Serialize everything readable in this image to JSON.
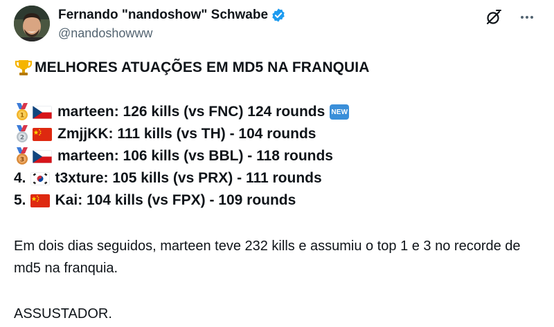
{
  "author": {
    "display_name": "Fernando \"nandoshow\" Schwabe",
    "handle": "@nandoshowww",
    "verified": true
  },
  "header_actions": {
    "icons": [
      "grok-icon",
      "more-icon"
    ]
  },
  "tweet": {
    "headline": "MELHORES ATUAÇÕES EM MD5 NA FRANQUIA",
    "rankings": [
      {
        "rank_label": "",
        "medal": "gold",
        "flag": "czech",
        "text": "marteen: 126 kills (vs FNC) 124 rounds",
        "new_badge": "NEW"
      },
      {
        "rank_label": "",
        "medal": "silver",
        "flag": "china",
        "text": "ZmjjKK: 111 kills (vs TH) - 104 rounds"
      },
      {
        "rank_label": "",
        "medal": "bronze",
        "flag": "czech",
        "text": "marteen: 106 kills (vs BBL) - 118 rounds"
      },
      {
        "rank_label": "4.",
        "medal": "",
        "flag": "korea",
        "text": "t3xture: 105 kills (vs PRX) - 111 rounds"
      },
      {
        "rank_label": "5.",
        "medal": "",
        "flag": "china",
        "text": "Kai: 104 kills (vs FPX) - 109 rounds"
      }
    ],
    "paragraph": "Em dois dias seguidos, marteen teve 232 kills e assumiu o top 1 e 3 no recorde de md5 na franquia.",
    "closing": "ASSUSTADOR."
  },
  "colors": {
    "text": "#0f1419",
    "secondary": "#536471",
    "verified": "#1d9bf0",
    "new_badge": "#3a8fd9"
  }
}
